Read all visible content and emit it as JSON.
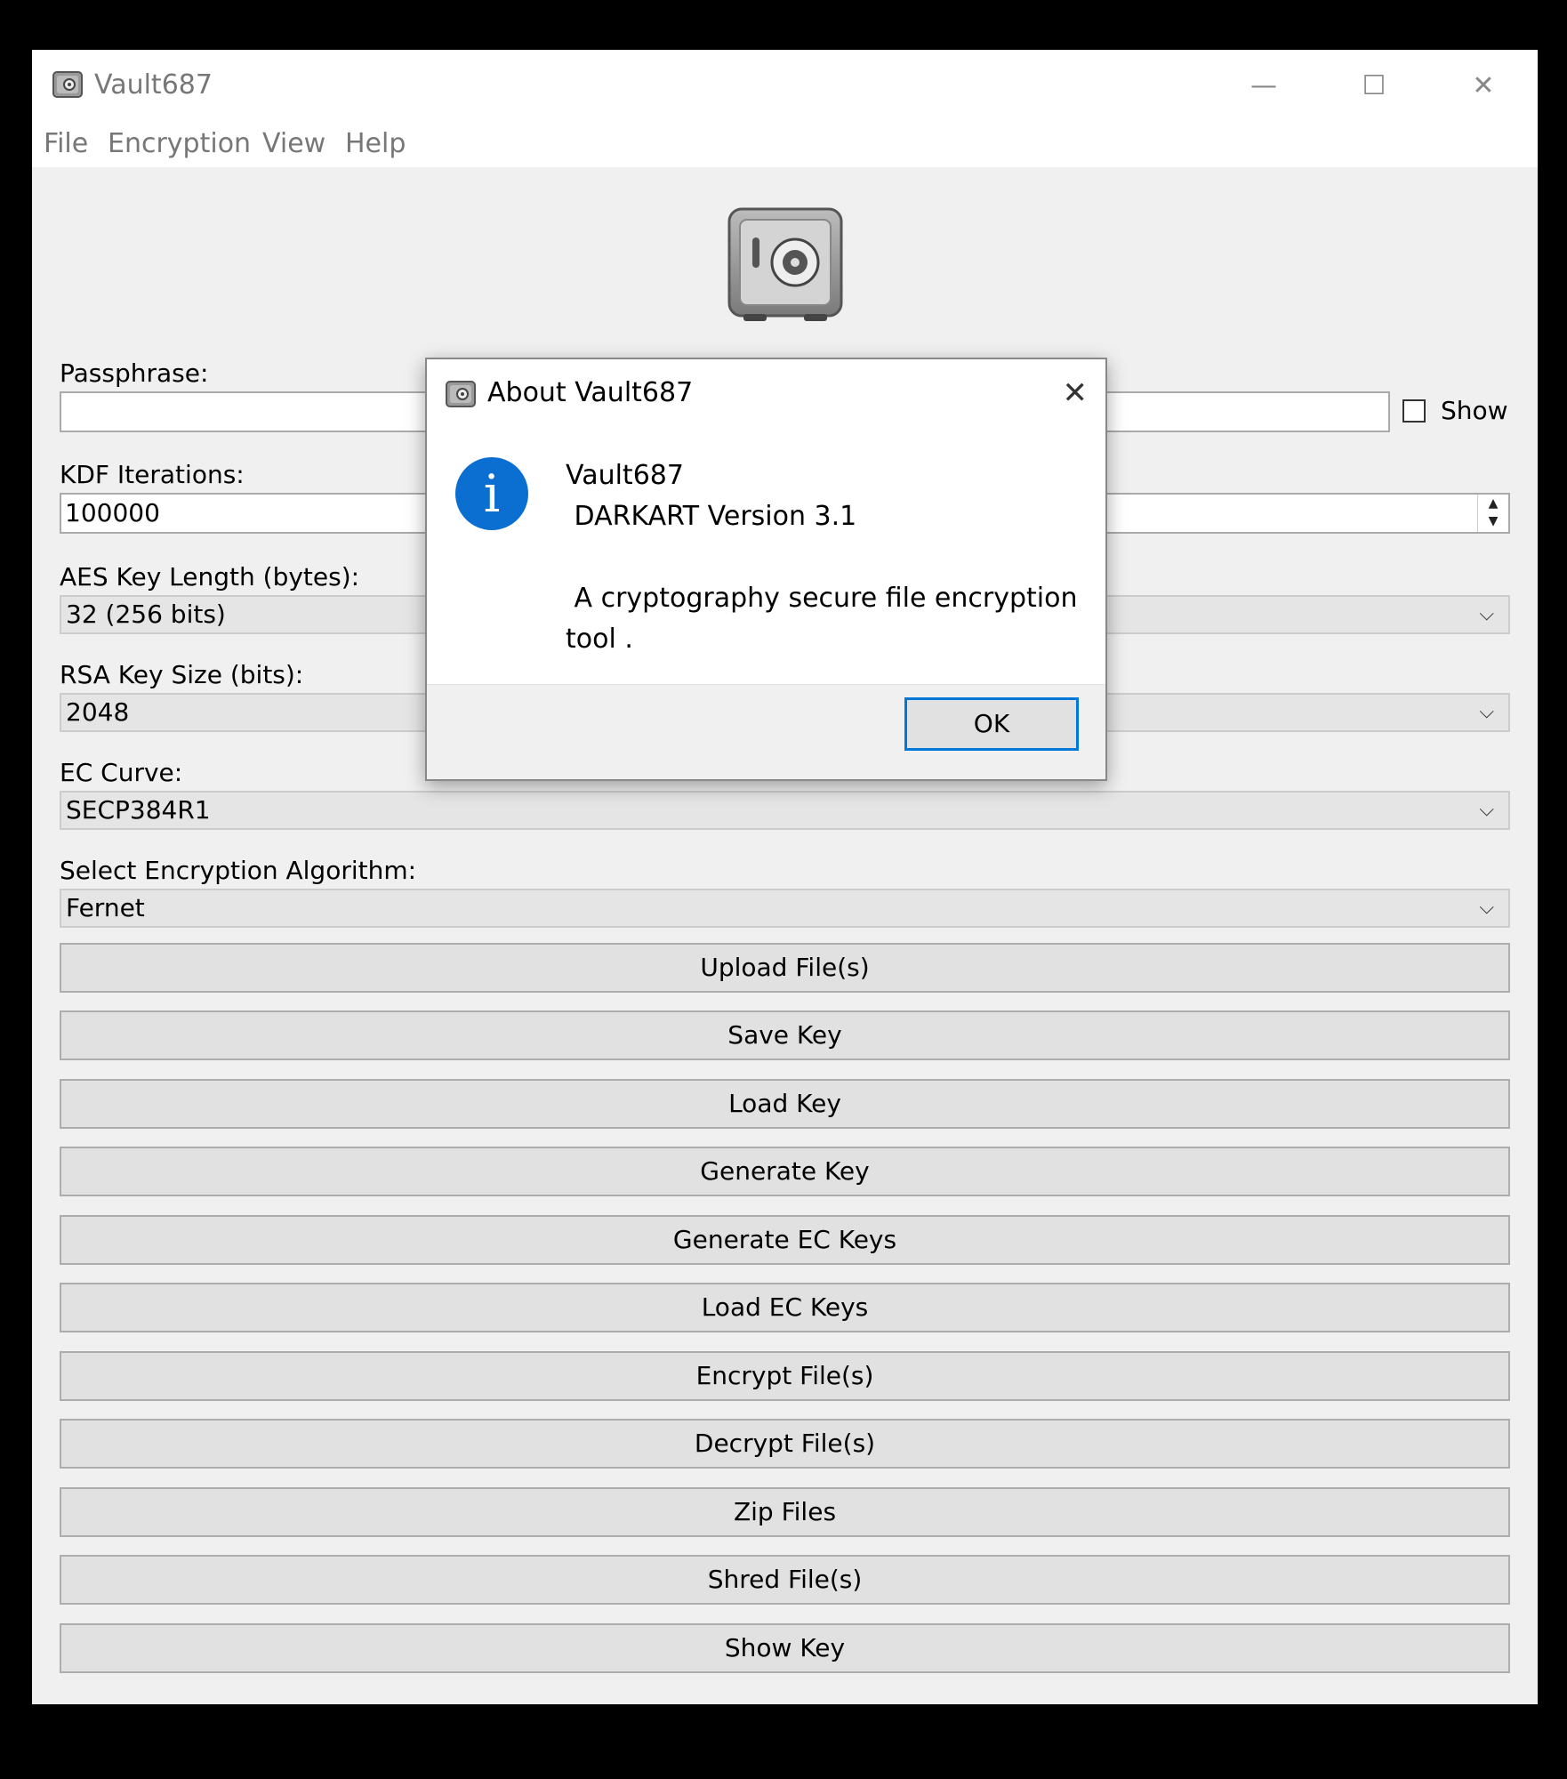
{
  "window": {
    "title": "Vault687",
    "controls": {
      "minimize": "—",
      "maximize": "☐",
      "close": "✕"
    }
  },
  "menu": [
    "File",
    "Encryption",
    "View",
    "Help"
  ],
  "form": {
    "passphrase_label": "Passphrase:",
    "passphrase_value": "",
    "show_label": "Show",
    "show_checked": false,
    "kdf_label": "KDF Iterations:",
    "kdf_value": "100000",
    "aes_label": "AES Key Length (bytes):",
    "aes_value": "32 (256 bits)",
    "rsa_label": "RSA Key Size (bits):",
    "rsa_value": "2048",
    "ec_label": "EC Curve:",
    "ec_value": "SECP384R1",
    "algo_label": "Select Encryption Algorithm:",
    "algo_value": "Fernet"
  },
  "buttons": [
    "Upload File(s)",
    "Save Key",
    "Load Key",
    "Generate Key",
    "Generate EC Keys",
    "Load EC Keys",
    "Encrypt File(s)",
    "Decrypt File(s)",
    "Zip Files",
    "Shred File(s)",
    "Show Key"
  ],
  "dialog": {
    "title": "About Vault687",
    "close": "✕",
    "icon": "info-icon",
    "line1": "Vault687",
    "line2": " DARKART Version 3.1",
    "line3": " A cryptography secure file encryption",
    "line4": "tool .",
    "ok_label": "OK"
  },
  "colors": {
    "accent": "#0078d7",
    "info_icon": "#0a6fd1"
  }
}
